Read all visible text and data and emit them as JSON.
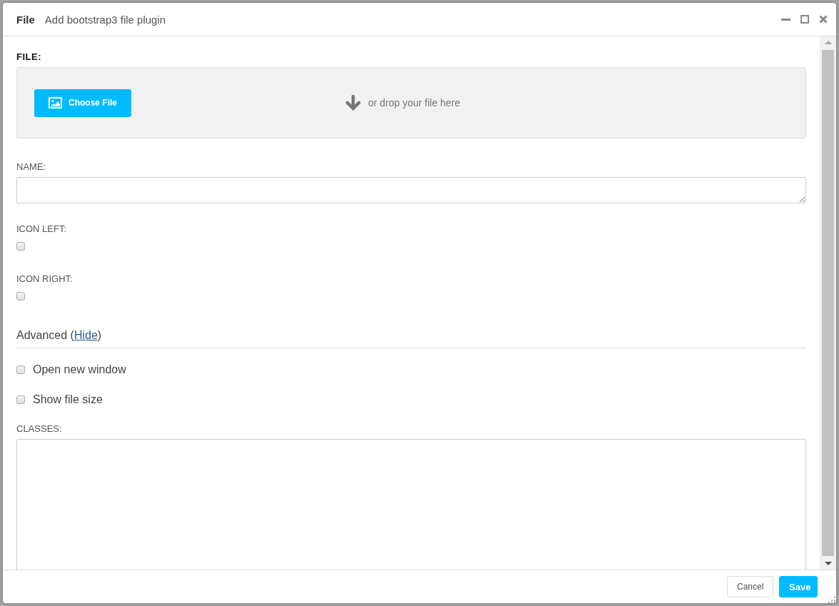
{
  "window": {
    "title": "File",
    "subtitle": "Add bootstrap3 file plugin"
  },
  "file_field": {
    "label": "FILE:",
    "button": "Choose File",
    "drop_hint": "or drop your file here"
  },
  "name_field": {
    "label": "NAME:"
  },
  "icon_left": {
    "label": "ICON LEFT:",
    "checked": false
  },
  "icon_right": {
    "label": "ICON RIGHT:",
    "checked": false
  },
  "advanced": {
    "prefix": "Advanced (",
    "link": "Hide",
    "suffix": ")"
  },
  "options": [
    {
      "label": "Open new window",
      "checked": false
    },
    {
      "label": "Show file size",
      "checked": false
    }
  ],
  "classes_field": {
    "label": "CLASSES:"
  },
  "buttons": [
    {
      "label": "Cancel",
      "kind": "secondary"
    },
    {
      "label": "Save",
      "kind": "primary"
    }
  ]
}
